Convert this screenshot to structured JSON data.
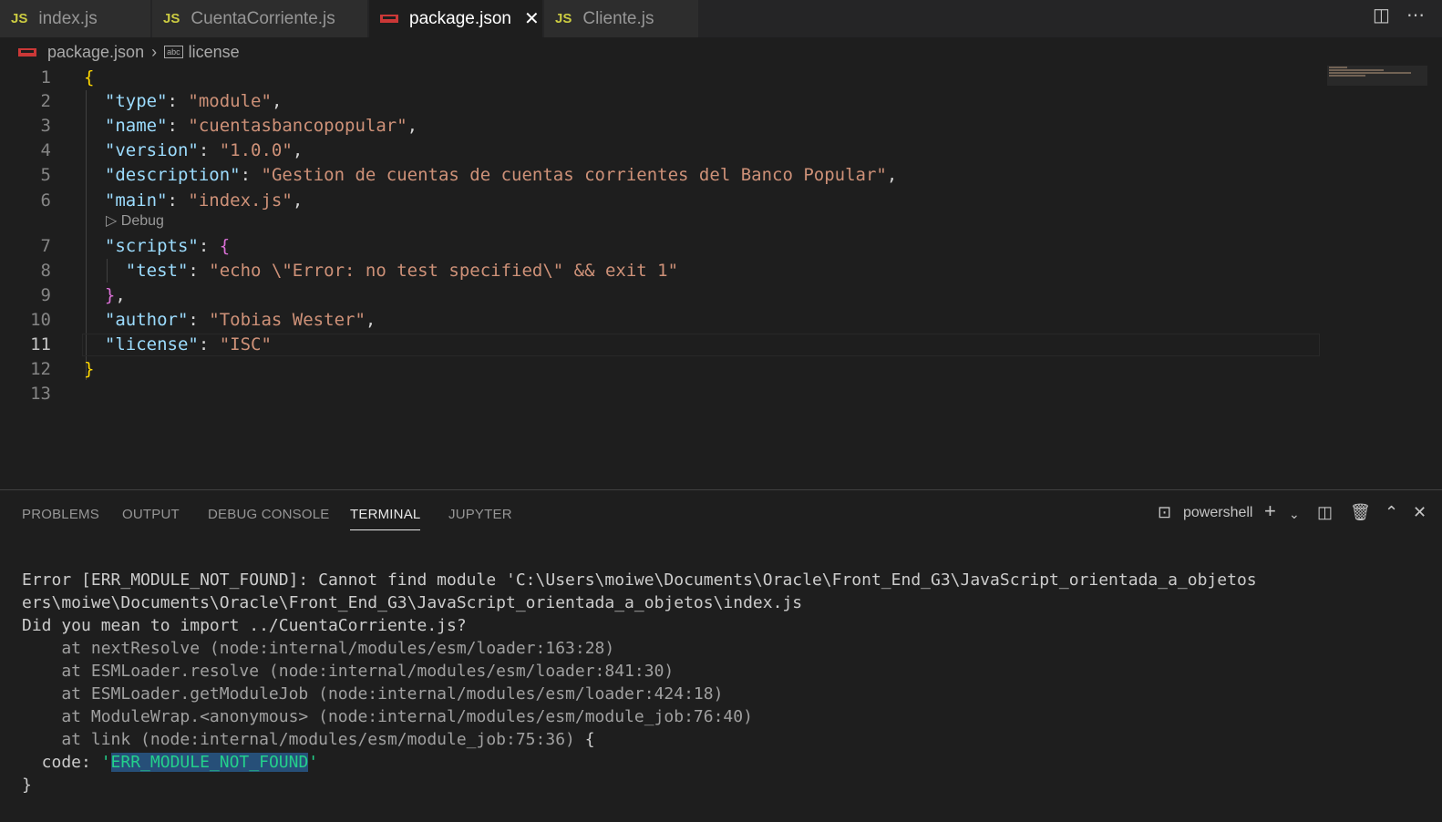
{
  "tabs": [
    {
      "label": "index.js",
      "icon": "JS"
    },
    {
      "label": "CuentaCorriente.js",
      "icon": "JS"
    },
    {
      "label": "package.json",
      "icon": "npm"
    },
    {
      "label": "Cliente.js",
      "icon": "JS"
    }
  ],
  "breadcrumb": {
    "file": "package.json",
    "symbol": "license"
  },
  "editor": {
    "line_numbers": [
      "1",
      "2",
      "3",
      "4",
      "5",
      "6",
      "7",
      "8",
      "9",
      "10",
      "11",
      "12",
      "13"
    ],
    "codelens": "Debug",
    "lines": {
      "l1": "{",
      "l2k": "\"type\"",
      "l2v": "\"module\"",
      "l3k": "\"name\"",
      "l3v": "\"cuentasbancopopular\"",
      "l4k": "\"version\"",
      "l4v": "\"1.0.0\"",
      "l5k": "\"description\"",
      "l5v": "\"Gestion de cuentas de cuentas corrientes del Banco Popular\"",
      "l6k": "\"main\"",
      "l6v": "\"index.js\"",
      "l7k": "\"scripts\"",
      "l7b": "{",
      "l8k": "\"test\"",
      "l8v": "\"echo \\\"Error: no test specified\\\" && exit 1\"",
      "l9": "}",
      "l10k": "\"author\"",
      "l10v": "\"Tobias Wester\"",
      "l11k": "\"license\"",
      "l11v": "\"ISC\"",
      "l12": "}"
    }
  },
  "panel": {
    "tabs": [
      "PROBLEMS",
      "OUTPUT",
      "DEBUG CONSOLE",
      "TERMINAL",
      "JUPYTER"
    ],
    "shell": "powershell",
    "terminal": {
      "t1": "Error [ERR_MODULE_NOT_FOUND]: Cannot find module 'C:\\Users\\moiwe\\Documents\\Oracle\\Front_End_G3\\JavaScript_orientada_a_objetos",
      "t2": "ers\\moiwe\\Documents\\Oracle\\Front_End_G3\\JavaScript_orientada_a_objetos\\index.js",
      "t3": "Did you mean to import ../CuentaCorriente.js?",
      "t4": "    at nextResolve (node:internal/modules/esm/loader:163:28)",
      "t5": "    at ESMLoader.resolve (node:internal/modules/esm/loader:841:30)",
      "t6": "    at ESMLoader.getModuleJob (node:internal/modules/esm/loader:424:18)",
      "t7": "    at ModuleWrap.<anonymous> (node:internal/modules/esm/module_job:76:40)",
      "t8a": "    at link (node:internal/modules/esm/module_job:75:36) ",
      "t8b": "{",
      "code_label": "  code: ",
      "code_value": "ERR_MODULE_NOT_FOUND",
      "t10": "}"
    }
  },
  "colors": {
    "editor_bg": "#1e1e1e",
    "key": "#9cdcfe",
    "string": "#ce9178",
    "bracket": "#ffd700"
  }
}
